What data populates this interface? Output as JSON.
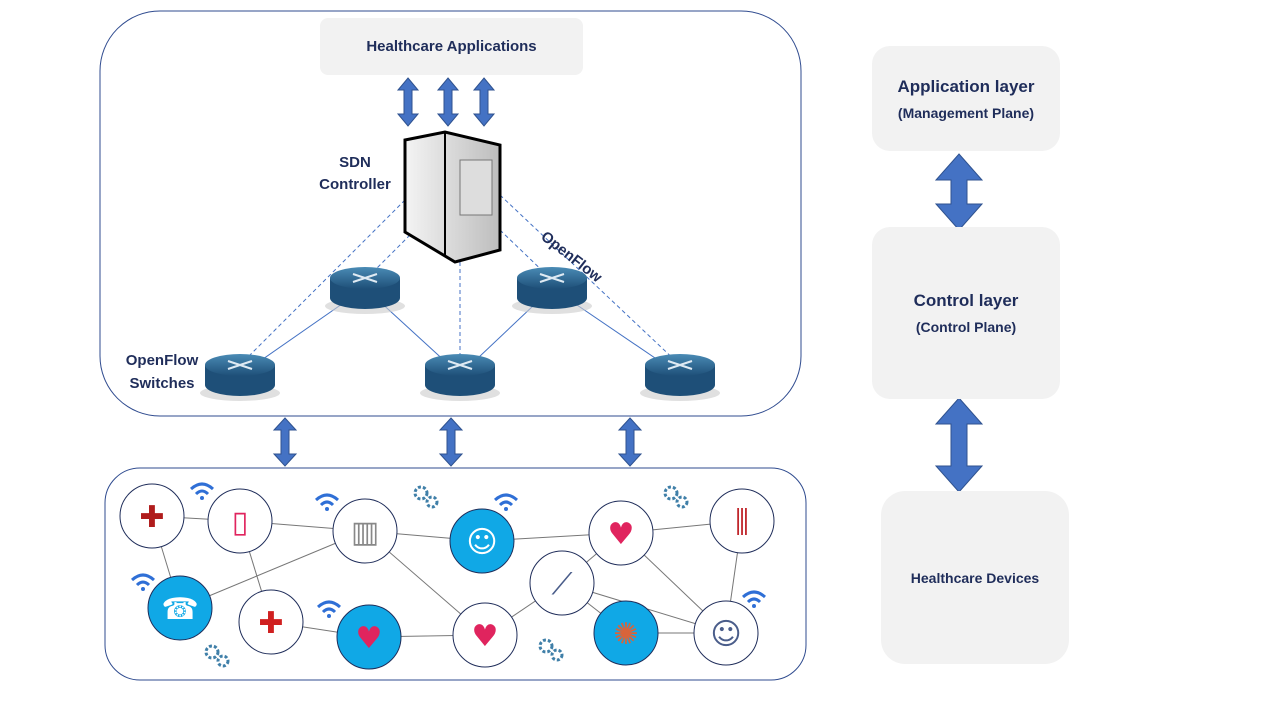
{
  "colors": {
    "arrow": "#4472C4",
    "text": "#1f2d5a",
    "box": "#f2f2f2",
    "frame": "#2f4b8f",
    "node_blue": "#10a8e6"
  },
  "top": {
    "apps": "Healthcare Applications",
    "controller": [
      "SDN",
      "Controller"
    ],
    "openflow": "OpenFlow",
    "switches": [
      "OpenFlow",
      "Switches"
    ]
  },
  "layers": [
    {
      "title": "Application  layer",
      "subtitle": "(Management Plane)"
    },
    {
      "title": "Control  layer",
      "subtitle": "(Control Plane)"
    },
    {
      "title": "Healthcare Devices"
    }
  ],
  "devices": [
    "star-of-life-icon",
    "medical-app-icon",
    "hospital-icon",
    "telemedicine-doctor-icon",
    "heart-monitor-icon",
    "test-tubes-icon",
    "doctor-call-icon",
    "ambulance-icon",
    "phone-heart-icon",
    "tablet-diagnosis-icon",
    "syringe-icon",
    "virus-microscope-icon",
    "doctor-desk-icon"
  ]
}
